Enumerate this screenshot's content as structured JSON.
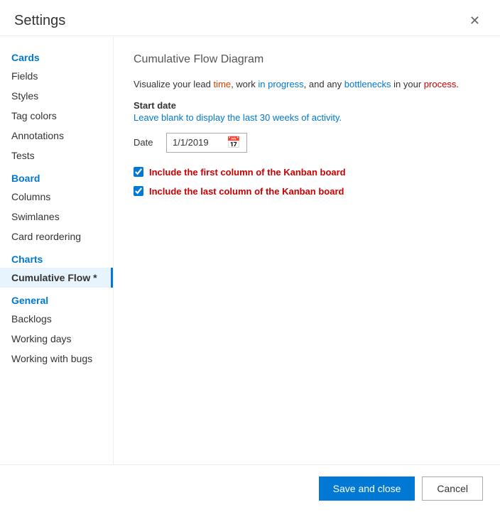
{
  "dialog": {
    "title": "Settings",
    "close_label": "✕"
  },
  "sidebar": {
    "sections": [
      {
        "label": "Cards",
        "items": [
          {
            "id": "fields",
            "label": "Fields",
            "active": false
          },
          {
            "id": "styles",
            "label": "Styles",
            "active": false
          },
          {
            "id": "tag-colors",
            "label": "Tag colors",
            "active": false
          },
          {
            "id": "annotations",
            "label": "Annotations",
            "active": false
          },
          {
            "id": "tests",
            "label": "Tests",
            "active": false
          }
        ]
      },
      {
        "label": "Board",
        "items": [
          {
            "id": "columns",
            "label": "Columns",
            "active": false
          },
          {
            "id": "swimlanes",
            "label": "Swimlanes",
            "active": false
          },
          {
            "id": "card-reordering",
            "label": "Card reordering",
            "active": false
          }
        ]
      },
      {
        "label": "Charts",
        "items": [
          {
            "id": "cumulative-flow",
            "label": "Cumulative Flow *",
            "active": true
          }
        ]
      },
      {
        "label": "General",
        "items": [
          {
            "id": "backlogs",
            "label": "Backlogs",
            "active": false
          },
          {
            "id": "working-days",
            "label": "Working days",
            "active": false
          },
          {
            "id": "working-with-bugs",
            "label": "Working with bugs",
            "active": false
          }
        ]
      }
    ]
  },
  "main": {
    "section_title": "Cumulative Flow Diagram",
    "description": {
      "part1": "Visualize your lead ",
      "word1": "time",
      "part2": ", work ",
      "word2": "in progress",
      "part3": ", and any ",
      "word3": "bottlenecks",
      "part4": " in your ",
      "word4": "process",
      "part5": "."
    },
    "start_date_label": "Start date",
    "start_date_hint": "Leave blank to display the last 30 weeks of activity.",
    "date_label": "Date",
    "date_value": "1/1/2019",
    "checkbox1_label": "Include the first column of the Kanban board",
    "checkbox1_checked": true,
    "checkbox2_label": "Include the last column of the Kanban board",
    "checkbox2_checked": true
  },
  "footer": {
    "save_label": "Save and close",
    "cancel_label": "Cancel"
  }
}
